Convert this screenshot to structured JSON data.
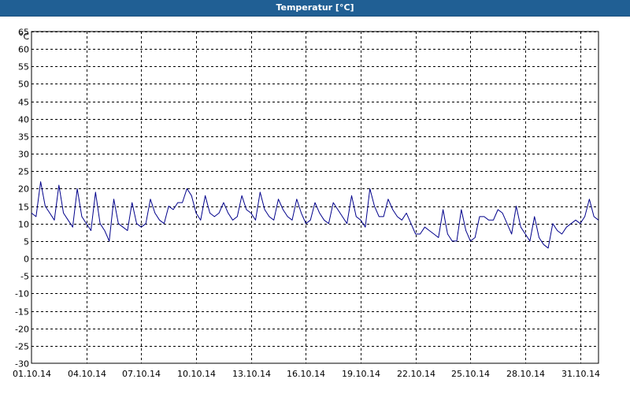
{
  "window": {
    "title": "Temperatur [°C]"
  },
  "colors": {
    "titlebar": "#205f94",
    "series": "#00008b",
    "grid": "#000000"
  },
  "chart_data": {
    "type": "line",
    "title": "Temperatur [°C]",
    "ylabel": "°C",
    "ylim": [
      -30,
      65
    ],
    "yticks": [
      65,
      60,
      55,
      50,
      45,
      40,
      35,
      30,
      25,
      20,
      15,
      10,
      5,
      0,
      -5,
      -10,
      -15,
      -20,
      -25,
      -30
    ],
    "xlim": [
      "01.10.14",
      "01.11.14"
    ],
    "xticks": [
      "01.10.14",
      "04.10.14",
      "07.10.14",
      "10.10.14",
      "13.10.14",
      "16.10.14",
      "19.10.14",
      "22.10.14",
      "25.10.14",
      "28.10.14",
      "31.10.14"
    ],
    "grid": true,
    "series": [
      {
        "color": "#00008b",
        "x": [
          "01.10.14 00:00",
          "01.10.14 06:00",
          "01.10.14 12:00",
          "01.10.14 18:00",
          "02.10.14 00:00",
          "02.10.14 06:00",
          "02.10.14 12:00",
          "02.10.14 18:00",
          "03.10.14 00:00",
          "03.10.14 06:00",
          "03.10.14 12:00",
          "03.10.14 18:00",
          "04.10.14 00:00",
          "04.10.14 06:00",
          "04.10.14 12:00",
          "04.10.14 18:00",
          "05.10.14 00:00",
          "05.10.14 06:00",
          "05.10.14 12:00",
          "05.10.14 18:00",
          "06.10.14 00:00",
          "06.10.14 06:00",
          "06.10.14 12:00",
          "06.10.14 18:00",
          "07.10.14 00:00",
          "07.10.14 06:00",
          "07.10.14 12:00",
          "07.10.14 18:00",
          "08.10.14 00:00",
          "08.10.14 06:00",
          "08.10.14 12:00",
          "08.10.14 18:00",
          "09.10.14 00:00",
          "09.10.14 06:00",
          "09.10.14 12:00",
          "09.10.14 18:00",
          "10.10.14 00:00",
          "10.10.14 06:00",
          "10.10.14 12:00",
          "10.10.14 18:00",
          "11.10.14 00:00",
          "11.10.14 06:00",
          "11.10.14 12:00",
          "11.10.14 18:00",
          "12.10.14 00:00",
          "12.10.14 06:00",
          "12.10.14 12:00",
          "12.10.14 18:00",
          "13.10.14 00:00",
          "13.10.14 06:00",
          "13.10.14 12:00",
          "13.10.14 18:00",
          "14.10.14 00:00",
          "14.10.14 06:00",
          "14.10.14 12:00",
          "14.10.14 18:00",
          "15.10.14 00:00",
          "15.10.14 06:00",
          "15.10.14 12:00",
          "15.10.14 18:00",
          "16.10.14 00:00",
          "16.10.14 06:00",
          "16.10.14 12:00",
          "16.10.14 18:00",
          "17.10.14 00:00",
          "17.10.14 06:00",
          "17.10.14 12:00",
          "17.10.14 18:00",
          "18.10.14 00:00",
          "18.10.14 06:00",
          "18.10.14 12:00",
          "18.10.14 18:00",
          "19.10.14 00:00",
          "19.10.14 06:00",
          "19.10.14 12:00",
          "19.10.14 18:00",
          "20.10.14 00:00",
          "20.10.14 06:00",
          "20.10.14 12:00",
          "20.10.14 18:00",
          "21.10.14 00:00",
          "21.10.14 06:00",
          "21.10.14 12:00",
          "21.10.14 18:00",
          "22.10.14 00:00",
          "22.10.14 06:00",
          "22.10.14 12:00",
          "22.10.14 18:00",
          "23.10.14 00:00",
          "23.10.14 06:00",
          "23.10.14 12:00",
          "23.10.14 18:00",
          "24.10.14 00:00",
          "24.10.14 06:00",
          "24.10.14 12:00",
          "24.10.14 18:00",
          "25.10.14 00:00",
          "25.10.14 06:00",
          "25.10.14 12:00",
          "25.10.14 18:00",
          "26.10.14 00:00",
          "26.10.14 06:00",
          "26.10.14 12:00",
          "26.10.14 18:00",
          "27.10.14 00:00",
          "27.10.14 06:00",
          "27.10.14 12:00",
          "27.10.14 18:00",
          "28.10.14 00:00",
          "28.10.14 06:00",
          "28.10.14 12:00",
          "28.10.14 18:00",
          "29.10.14 00:00",
          "29.10.14 06:00",
          "29.10.14 12:00",
          "29.10.14 18:00",
          "30.10.14 00:00",
          "30.10.14 06:00",
          "30.10.14 12:00",
          "30.10.14 18:00",
          "31.10.14 00:00",
          "31.10.14 06:00",
          "31.10.14 12:00",
          "31.10.14 18:00",
          "01.11.14 00:00"
        ],
        "y": [
          13,
          12,
          22,
          15,
          13,
          11,
          21,
          13,
          11,
          9,
          20,
          12,
          10,
          8,
          19,
          10,
          8,
          5,
          17,
          10,
          9,
          8,
          16,
          10,
          9,
          10,
          17,
          13,
          11,
          10,
          15,
          14,
          16,
          16,
          20,
          18,
          13,
          11,
          18,
          13,
          12,
          13,
          16,
          13,
          11,
          12,
          18,
          14,
          13,
          11,
          19,
          14,
          12,
          11,
          17,
          14,
          12,
          11,
          17,
          13,
          10,
          11,
          16,
          13,
          11,
          10,
          16,
          14,
          12,
          10,
          18,
          12,
          11,
          9,
          20,
          15,
          12,
          12,
          17,
          14,
          12,
          11,
          13,
          10,
          7,
          7,
          9,
          8,
          7,
          6,
          14,
          7,
          5,
          5,
          14,
          8,
          5,
          6,
          12,
          12,
          11,
          11,
          14,
          13,
          10,
          7,
          15,
          9,
          7,
          5,
          12,
          6,
          4,
          3,
          10,
          8,
          7,
          9,
          10,
          11,
          10,
          12,
          17,
          12,
          11
        ]
      }
    ]
  }
}
